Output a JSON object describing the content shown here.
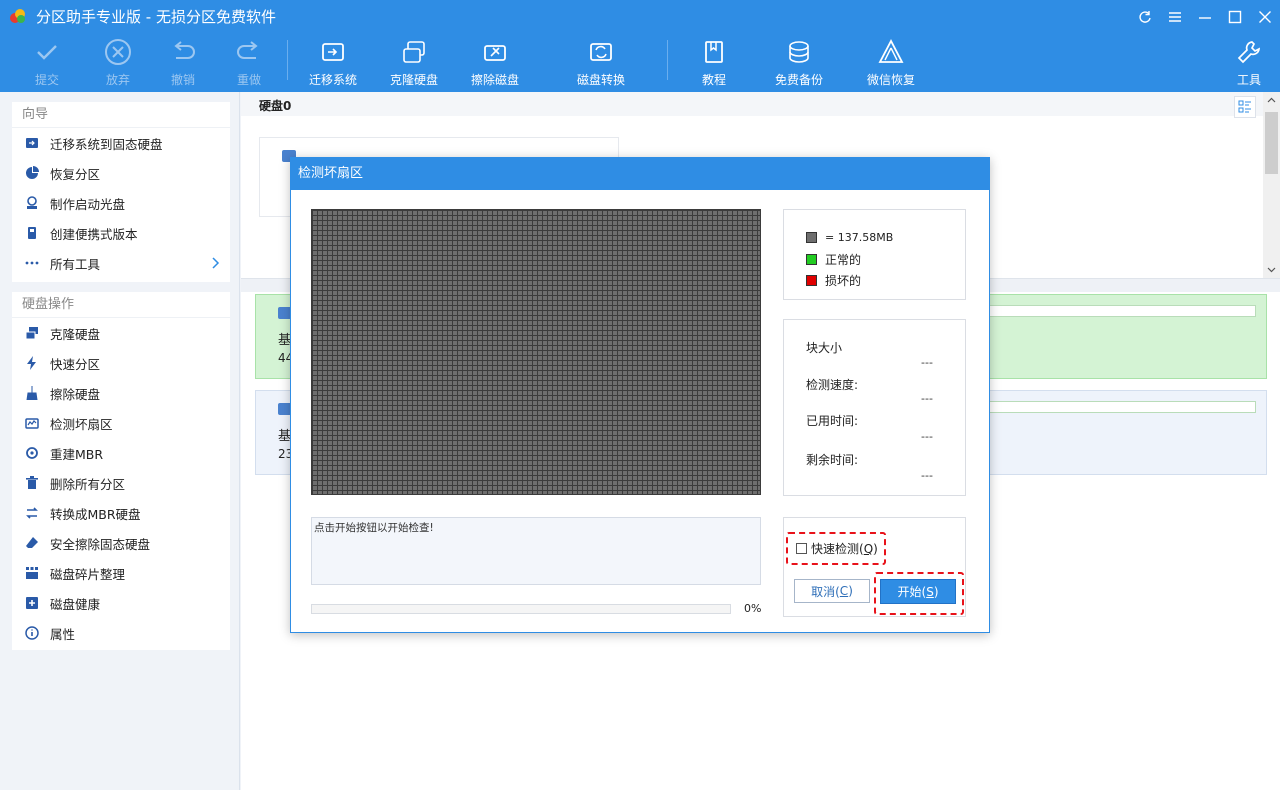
{
  "app": {
    "title": "分区助手专业版 - 无损分区免费软件"
  },
  "toolbar": {
    "commit": "提交",
    "discard": "放弃",
    "undo": "撤销",
    "redo": "重做",
    "migrate_os": "迁移系统",
    "clone_disk": "克隆硬盘",
    "wipe_disk": "擦除磁盘",
    "disk_convert": "磁盘转换",
    "tutorial": "教程",
    "free_backup": "免费备份",
    "wechat_recovery": "微信恢复",
    "tools": "工具"
  },
  "sidebar": {
    "wizard_title": "向导",
    "wizard_items": [
      {
        "label": "迁移系统到固态硬盘"
      },
      {
        "label": "恢复分区"
      },
      {
        "label": "制作启动光盘"
      },
      {
        "label": "创建便携式版本"
      },
      {
        "label": "所有工具"
      }
    ],
    "disk_ops_title": "硬盘操作",
    "disk_ops_items": [
      {
        "label": "克隆硬盘"
      },
      {
        "label": "快速分区"
      },
      {
        "label": "擦除硬盘"
      },
      {
        "label": "检测坏扇区"
      },
      {
        "label": "重建MBR"
      },
      {
        "label": "删除所有分区"
      },
      {
        "label": "转换成MBR硬盘"
      },
      {
        "label": "安全擦除固态硬盘"
      },
      {
        "label": "磁盘碎片整理"
      },
      {
        "label": "磁盘健康"
      },
      {
        "label": "属性"
      }
    ]
  },
  "main": {
    "disk_title": "硬盘0",
    "rows": [
      {
        "label": "基",
        "size": "44"
      },
      {
        "label": "基",
        "size": "23"
      }
    ]
  },
  "dialog": {
    "title": "检测坏扇区",
    "legend": {
      "block": "= 137.58MB",
      "normal": "正常的",
      "bad": "损坏的"
    },
    "stats": {
      "block_size_label": "块大小",
      "block_size_value": "---",
      "speed_label": "检测速度:",
      "speed_value": "---",
      "elapsed_label": "已用时间:",
      "elapsed_value": "---",
      "remaining_label": "剩余时间:",
      "remaining_value": "---"
    },
    "message": "点击开始按钮以开始检查!",
    "progress_text": "0%",
    "progress": 0,
    "quick_check_label": "快速检测(",
    "quick_check_key": "Q",
    "cancel_label": "取消(",
    "cancel_key": "C",
    "start_label": "开始(",
    "start_key": "S",
    "close_paren": ")",
    "colors": {
      "block": "#6e6e6e",
      "normal": "#22cc22",
      "bad": "#e00000",
      "accent": "#2f8de4"
    }
  }
}
